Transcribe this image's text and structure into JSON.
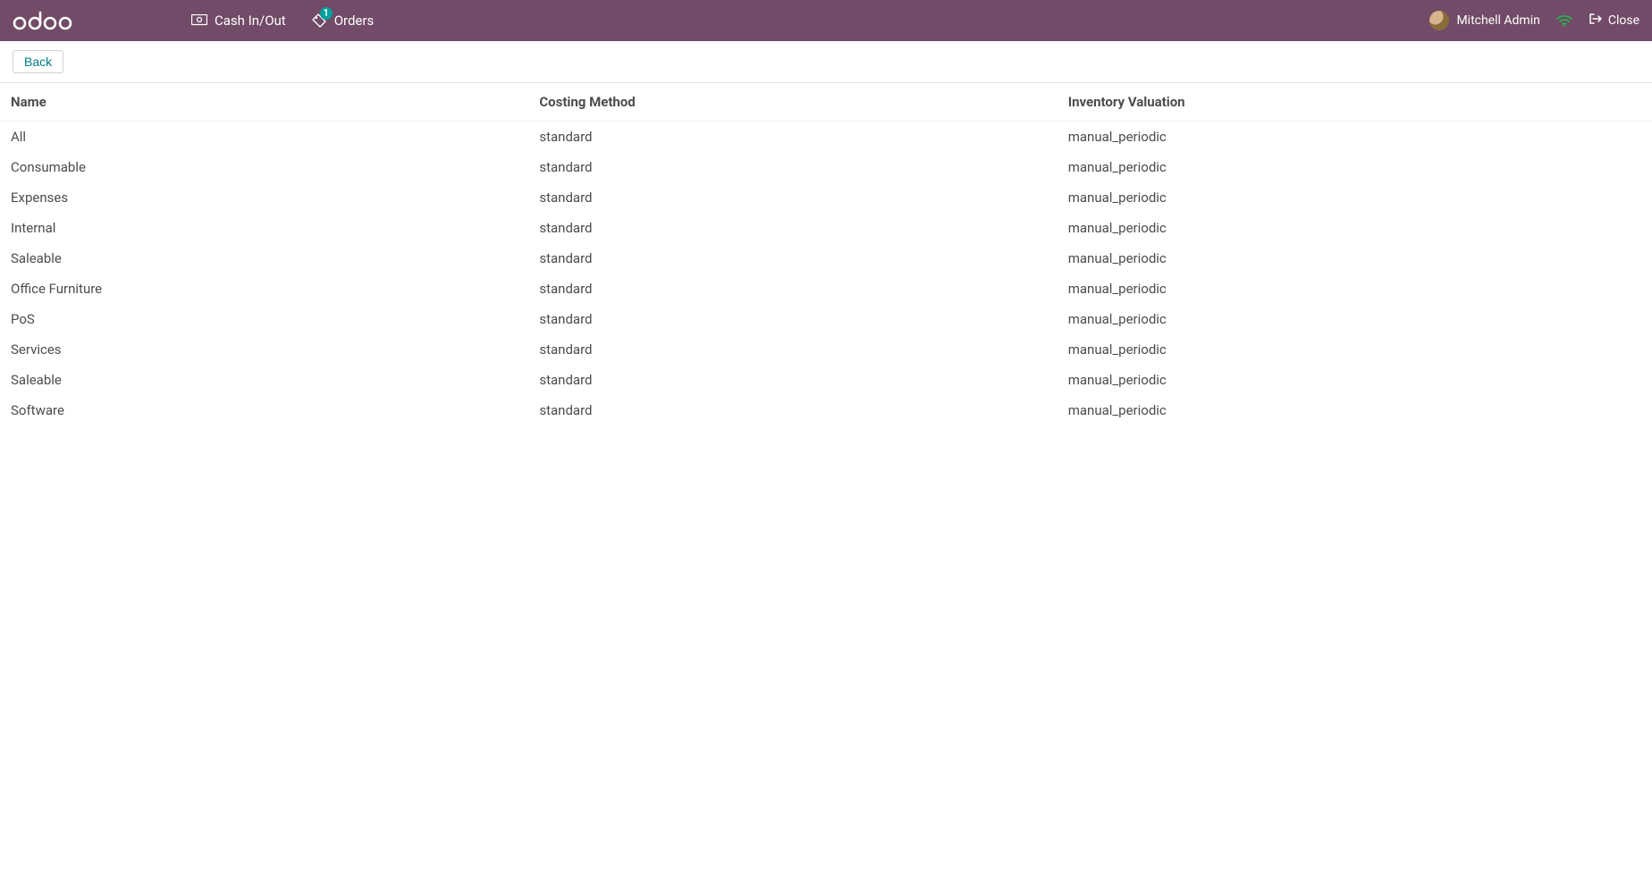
{
  "topbar": {
    "logo_text": "odoo",
    "cash_label": "Cash In/Out",
    "orders_label": "Orders",
    "orders_badge": "1",
    "user_name": "Mitchell Admin",
    "close_label": "Close"
  },
  "subbar": {
    "back_label": "Back"
  },
  "table": {
    "headers": {
      "name": "Name",
      "costing": "Costing Method",
      "valuation": "Inventory Valuation"
    },
    "rows": [
      {
        "name": "All",
        "costing": "standard",
        "valuation": "manual_periodic"
      },
      {
        "name": "Consumable",
        "costing": "standard",
        "valuation": "manual_periodic"
      },
      {
        "name": "Expenses",
        "costing": "standard",
        "valuation": "manual_periodic"
      },
      {
        "name": "Internal",
        "costing": "standard",
        "valuation": "manual_periodic"
      },
      {
        "name": "Saleable",
        "costing": "standard",
        "valuation": "manual_periodic"
      },
      {
        "name": "Office Furniture",
        "costing": "standard",
        "valuation": "manual_periodic"
      },
      {
        "name": "PoS",
        "costing": "standard",
        "valuation": "manual_periodic"
      },
      {
        "name": "Services",
        "costing": "standard",
        "valuation": "manual_periodic"
      },
      {
        "name": "Saleable",
        "costing": "standard",
        "valuation": "manual_periodic"
      },
      {
        "name": "Software",
        "costing": "standard",
        "valuation": "manual_periodic"
      }
    ]
  }
}
